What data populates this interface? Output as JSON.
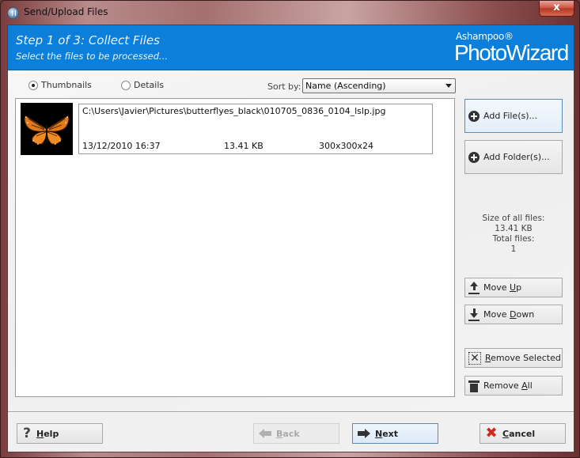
{
  "window": {
    "title": "Send/Upload Files",
    "close_label": "x"
  },
  "banner": {
    "step_title": "Step 1 of 3: Collect Files",
    "subtitle": "Select the files to be processed...",
    "brand_small": "Ashampoo®",
    "brand_big": "PhotoWizard"
  },
  "view": {
    "thumbnails_label": "Thumbnails",
    "details_label": "Details",
    "selected": "Thumbnails",
    "sort_label": "Sort by:",
    "sort_value": "Name (Ascending)"
  },
  "files": [
    {
      "path": "C:\\Users\\Javier\\Pictures\\butterflyes_black\\010705_0836_0104_lslp.jpg",
      "date": "13/12/2010 16:37",
      "size": "13.41 KB",
      "dimensions": "300x300x24",
      "thumbnail": "butterfly-icon"
    }
  ],
  "side_buttons": {
    "add_files": "Add File(s)...",
    "add_folders": "Add Folder(s)...",
    "move_up_pre": "Move ",
    "move_up_key": "U",
    "move_up_post": "p",
    "move_down_pre": "Move ",
    "move_down_key": "D",
    "move_down_post": "own",
    "remove_selected_key": "R",
    "remove_selected_post": "emove Selected",
    "remove_all_pre": "Remove ",
    "remove_all_key": "A",
    "remove_all_post": "ll"
  },
  "stats": {
    "size_label": "Size of all files:",
    "size_value": "13.41 KB",
    "count_label": "Total files:",
    "count_value": "1"
  },
  "footer": {
    "help_key": "H",
    "help_post": "elp",
    "back_key": "B",
    "back_post": "ack",
    "next_key": "N",
    "next_post": "ext",
    "cancel_key": "C",
    "cancel_post": "ancel",
    "help_icon": "?",
    "cancel_icon": "✖"
  }
}
